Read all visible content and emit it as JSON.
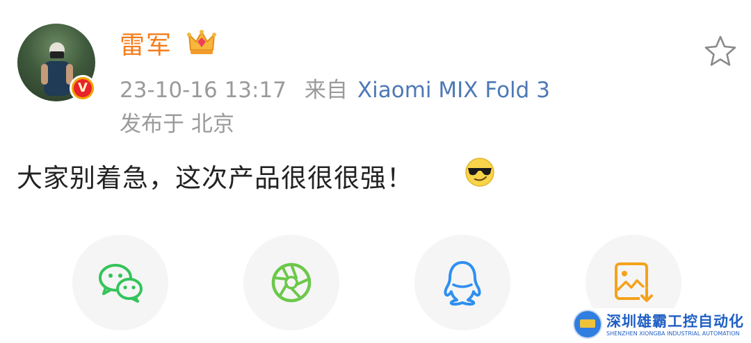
{
  "post": {
    "username": "雷军",
    "timestamp": "23-10-16 13:17",
    "source_prefix": "来自",
    "device": "Xiaomi MIX Fold 3",
    "location": "发布于 北京",
    "content": "大家别着急，这次产品很很很强！"
  },
  "badges": {
    "verified": "V"
  },
  "icons": {
    "crown": "crown-icon",
    "favorite": "star-icon",
    "emoji": "cool-sunglasses-emoji"
  },
  "share_targets": [
    {
      "icon": "wechat-icon",
      "color": "#34c45a"
    },
    {
      "icon": "moments-icon",
      "color": "#6cc84a"
    },
    {
      "icon": "qq-icon",
      "color": "#2e8ff0"
    },
    {
      "icon": "save-image-icon",
      "color": "#f5a21b"
    }
  ],
  "watermark": {
    "cn": "深圳雄霸工控自动化",
    "en": "SHENZHEN XIONGBA INDUSTRIAL AUTOMATION"
  },
  "colors": {
    "username": "#f47d1b",
    "meta": "#9a9a9a",
    "device_link": "#4d78b6",
    "text": "#222222"
  }
}
